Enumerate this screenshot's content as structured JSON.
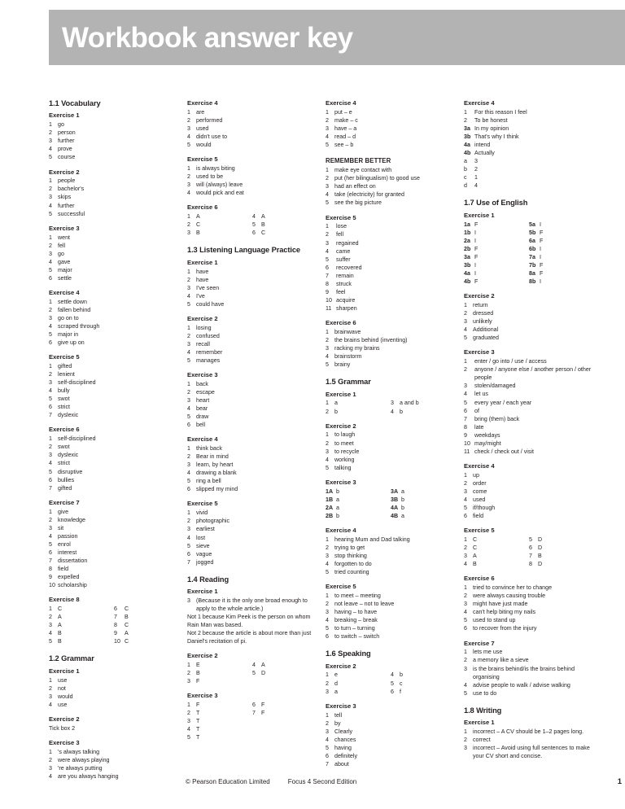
{
  "header": {
    "title": "Workbook answer key"
  },
  "footer": {
    "copyright": "© Pearson Education Limited",
    "edition": "Focus 4 Second Edition",
    "page_number": "1"
  },
  "sections": {
    "s11": {
      "title": "1.1 Vocabulary"
    },
    "s12": {
      "title": "1.2 Grammar"
    },
    "s13": {
      "title": "1.3 Listening Language Practice"
    },
    "s14": {
      "title": "1.4 Reading"
    },
    "s15": {
      "title": "1.5 Grammar"
    },
    "s16": {
      "title": "1.6 Speaking"
    },
    "s17": {
      "title": "1.7 Use of English"
    },
    "s18": {
      "title": "1.8 Writing"
    }
  },
  "labels": {
    "ex1": "Exercise 1",
    "ex2": "Exercise 2",
    "ex3": "Exercise 3",
    "ex4": "Exercise 4",
    "ex5": "Exercise 5",
    "ex6": "Exercise 6",
    "ex7": "Exercise 7",
    "ex8": "Exercise 8",
    "remember_better": "REMEMBER BETTER"
  },
  "col1": {
    "v_ex1": [
      {
        "n": "1",
        "t": "go"
      },
      {
        "n": "2",
        "t": "person"
      },
      {
        "n": "3",
        "t": "further"
      },
      {
        "n": "4",
        "t": "prove"
      },
      {
        "n": "5",
        "t": "course"
      }
    ],
    "v_ex2": [
      {
        "n": "1",
        "t": "people"
      },
      {
        "n": "2",
        "t": "bachelor's"
      },
      {
        "n": "3",
        "t": "skips"
      },
      {
        "n": "4",
        "t": "further"
      },
      {
        "n": "5",
        "t": "successful"
      }
    ],
    "v_ex3": [
      {
        "n": "1",
        "t": "went"
      },
      {
        "n": "2",
        "t": "fell"
      },
      {
        "n": "3",
        "t": "go"
      },
      {
        "n": "4",
        "t": "gave"
      },
      {
        "n": "5",
        "t": "major"
      },
      {
        "n": "6",
        "t": "settle"
      }
    ],
    "v_ex4": [
      {
        "n": "1",
        "t": "settle down"
      },
      {
        "n": "2",
        "t": "fallen behind"
      },
      {
        "n": "3",
        "t": "go on to"
      },
      {
        "n": "4",
        "t": "scraped through"
      },
      {
        "n": "5",
        "t": "major in"
      },
      {
        "n": "6",
        "t": "give up on"
      }
    ],
    "v_ex5": [
      {
        "n": "1",
        "t": "gifted"
      },
      {
        "n": "2",
        "t": "lenient"
      },
      {
        "n": "3",
        "t": "self-disciplined"
      },
      {
        "n": "4",
        "t": "bully"
      },
      {
        "n": "5",
        "t": "swot"
      },
      {
        "n": "6",
        "t": "strict"
      },
      {
        "n": "7",
        "t": "dyslexic"
      }
    ],
    "v_ex6": [
      {
        "n": "1",
        "t": "self-disciplined"
      },
      {
        "n": "2",
        "t": "swot"
      },
      {
        "n": "3",
        "t": "dyslexic"
      },
      {
        "n": "4",
        "t": "strict"
      },
      {
        "n": "5",
        "t": "disruptive"
      },
      {
        "n": "6",
        "t": "bullies"
      },
      {
        "n": "7",
        "t": "gifted"
      }
    ],
    "v_ex7": [
      {
        "n": "1",
        "t": "give"
      },
      {
        "n": "2",
        "t": "knowledge"
      },
      {
        "n": "3",
        "t": "sit"
      },
      {
        "n": "4",
        "t": "passion"
      },
      {
        "n": "5",
        "t": "enrol"
      },
      {
        "n": "6",
        "t": "interest"
      },
      {
        "n": "7",
        "t": "dissertation"
      },
      {
        "n": "8",
        "t": "field"
      },
      {
        "n": "9",
        "t": "expelled"
      },
      {
        "n": "10",
        "t": "scholarship"
      }
    ],
    "v_ex8_left": [
      {
        "n": "1",
        "t": "C"
      },
      {
        "n": "2",
        "t": "A"
      },
      {
        "n": "3",
        "t": "A"
      },
      {
        "n": "4",
        "t": "B"
      },
      {
        "n": "5",
        "t": "B"
      }
    ],
    "v_ex8_right": [
      {
        "n": "6",
        "t": "C"
      },
      {
        "n": "7",
        "t": "B"
      },
      {
        "n": "8",
        "t": "C"
      },
      {
        "n": "9",
        "t": "A"
      },
      {
        "n": "10",
        "t": "C"
      }
    ],
    "g_ex1": [
      {
        "n": "1",
        "t": "use"
      },
      {
        "n": "2",
        "t": "not"
      },
      {
        "n": "3",
        "t": "would"
      },
      {
        "n": "4",
        "t": "use"
      }
    ],
    "g_ex2_text": "Tick box 2",
    "g_ex3": [
      {
        "n": "1",
        "t": "'s always talking"
      },
      {
        "n": "2",
        "t": "were always playing"
      },
      {
        "n": "3",
        "t": "'re always putting"
      },
      {
        "n": "4",
        "t": "are you always hanging"
      }
    ]
  },
  "col2": {
    "g_ex4": [
      {
        "n": "1",
        "t": "are"
      },
      {
        "n": "2",
        "t": "performed"
      },
      {
        "n": "3",
        "t": "used"
      },
      {
        "n": "4",
        "t": "didn't use to"
      },
      {
        "n": "5",
        "t": "would"
      }
    ],
    "g_ex5": [
      {
        "n": "1",
        "t": "is always biting"
      },
      {
        "n": "2",
        "t": "used to be"
      },
      {
        "n": "3",
        "t": "will (always) leave"
      },
      {
        "n": "4",
        "t": "would pick and eat"
      }
    ],
    "g_ex6_left": [
      {
        "n": "1",
        "t": "A"
      },
      {
        "n": "2",
        "t": "C"
      },
      {
        "n": "3",
        "t": "B"
      }
    ],
    "g_ex6_right": [
      {
        "n": "4",
        "t": "A"
      },
      {
        "n": "5",
        "t": "B"
      },
      {
        "n": "6",
        "t": "C"
      }
    ],
    "l_ex1": [
      {
        "n": "1",
        "t": "have"
      },
      {
        "n": "2",
        "t": "have"
      },
      {
        "n": "3",
        "t": "I've seen"
      },
      {
        "n": "4",
        "t": "I've"
      },
      {
        "n": "5",
        "t": "could have"
      }
    ],
    "l_ex2": [
      {
        "n": "1",
        "t": "losing"
      },
      {
        "n": "2",
        "t": "confused"
      },
      {
        "n": "3",
        "t": "recall"
      },
      {
        "n": "4",
        "t": "remember"
      },
      {
        "n": "5",
        "t": "manages"
      }
    ],
    "l_ex3": [
      {
        "n": "1",
        "t": "back"
      },
      {
        "n": "2",
        "t": "escape"
      },
      {
        "n": "3",
        "t": "heart"
      },
      {
        "n": "4",
        "t": "bear"
      },
      {
        "n": "5",
        "t": "draw"
      },
      {
        "n": "6",
        "t": "bell"
      }
    ],
    "l_ex4": [
      {
        "n": "1",
        "t": "think back"
      },
      {
        "n": "2",
        "t": "Bear in mind"
      },
      {
        "n": "3",
        "t": "learn, by heart"
      },
      {
        "n": "4",
        "t": "drawing a blank"
      },
      {
        "n": "5",
        "t": "ring a bell"
      },
      {
        "n": "6",
        "t": "slipped my mind"
      }
    ],
    "l_ex5": [
      {
        "n": "1",
        "t": "vivid"
      },
      {
        "n": "2",
        "t": "photographic"
      },
      {
        "n": "3",
        "t": "earliest"
      },
      {
        "n": "4",
        "t": "lost"
      },
      {
        "n": "5",
        "t": "sieve"
      },
      {
        "n": "6",
        "t": "vague"
      },
      {
        "n": "7",
        "t": "jogged"
      }
    ],
    "r_ex1_num": "3",
    "r_ex1_main": "(Because it is the only one broad enough to apply to the whole article.)",
    "r_ex1_p2": "Not 1 because Kim Peek is the person on whom Rain Man was based.",
    "r_ex1_p3": "Not 2 because the article is about more than just Daniel's recitation of pi.",
    "r_ex2_left": [
      {
        "n": "1",
        "t": "E"
      },
      {
        "n": "2",
        "t": "B"
      },
      {
        "n": "3",
        "t": "F"
      }
    ],
    "r_ex2_right": [
      {
        "n": "4",
        "t": "A"
      },
      {
        "n": "5",
        "t": "D"
      }
    ],
    "r_ex3_left": [
      {
        "n": "1",
        "t": "F"
      },
      {
        "n": "2",
        "t": "T"
      },
      {
        "n": "3",
        "t": "T"
      },
      {
        "n": "4",
        "t": "T"
      },
      {
        "n": "5",
        "t": "T"
      }
    ],
    "r_ex3_right": [
      {
        "n": "6",
        "t": "F"
      },
      {
        "n": "7",
        "t": "F"
      }
    ]
  },
  "col3": {
    "r_ex4": [
      {
        "n": "1",
        "t": "put – e"
      },
      {
        "n": "2",
        "t": "make – c"
      },
      {
        "n": "3",
        "t": "have – a"
      },
      {
        "n": "4",
        "t": "read – d"
      },
      {
        "n": "5",
        "t": "see – b"
      }
    ],
    "remember_better": [
      {
        "n": "1",
        "t": "make eye contact with"
      },
      {
        "n": "2",
        "t": "put (her bilingualism) to good use"
      },
      {
        "n": "3",
        "t": "had an effect on"
      },
      {
        "n": "4",
        "t": "take (electricity) for granted"
      },
      {
        "n": "5",
        "t": "see the big picture"
      }
    ],
    "r_ex5": [
      {
        "n": "1",
        "t": "lose"
      },
      {
        "n": "2",
        "t": "fell"
      },
      {
        "n": "3",
        "t": "regained"
      },
      {
        "n": "4",
        "t": "came"
      },
      {
        "n": "5",
        "t": "suffer"
      },
      {
        "n": "6",
        "t": "recovered"
      },
      {
        "n": "7",
        "t": "remain"
      },
      {
        "n": "8",
        "t": "struck"
      },
      {
        "n": "9",
        "t": "feel"
      },
      {
        "n": "10",
        "t": "acquire"
      },
      {
        "n": "11",
        "t": "sharpen"
      }
    ],
    "r_ex6": [
      {
        "n": "1",
        "t": "brainwave"
      },
      {
        "n": "2",
        "t": "the brains behind (inventing)"
      },
      {
        "n": "3",
        "t": "racking my brains"
      },
      {
        "n": "4",
        "t": "brainstorm"
      },
      {
        "n": "5",
        "t": "brainy"
      }
    ],
    "g5_ex1_left": [
      {
        "n": "1",
        "t": "a"
      },
      {
        "n": "2",
        "t": "b"
      }
    ],
    "g5_ex1_right": [
      {
        "n": "3",
        "t": "a and b"
      },
      {
        "n": "4",
        "t": "b"
      }
    ],
    "g5_ex2": [
      {
        "n": "1",
        "t": "to laugh"
      },
      {
        "n": "2",
        "t": "to meet"
      },
      {
        "n": "3",
        "t": "to recycle"
      },
      {
        "n": "4",
        "t": "working"
      },
      {
        "n": "5",
        "t": "talking"
      }
    ],
    "g5_ex3_left": [
      {
        "n": "1A",
        "t": "b"
      },
      {
        "n": "1B",
        "t": "a"
      },
      {
        "n": "2A",
        "t": "a"
      },
      {
        "n": "2B",
        "t": "b"
      }
    ],
    "g5_ex3_right": [
      {
        "n": "3A",
        "t": "a"
      },
      {
        "n": "3B",
        "t": "b"
      },
      {
        "n": "4A",
        "t": "b"
      },
      {
        "n": "4B",
        "t": "a"
      }
    ],
    "g5_ex4": [
      {
        "n": "1",
        "t": "hearing Mum and Dad talking"
      },
      {
        "n": "2",
        "t": "trying to get"
      },
      {
        "n": "3",
        "t": "stop thinking"
      },
      {
        "n": "4",
        "t": "forgotten to do"
      },
      {
        "n": "5",
        "t": "tried counting"
      }
    ],
    "g5_ex5": [
      {
        "n": "1",
        "t": "to meet – meeting"
      },
      {
        "n": "2",
        "t": "not leave – not to leave"
      },
      {
        "n": "3",
        "t": "having – to have"
      },
      {
        "n": "4",
        "t": "breaking – break"
      },
      {
        "n": "5",
        "t": "to turn – turning"
      },
      {
        "n": "6",
        "t": "to switch – switch"
      }
    ],
    "sp_ex2_left": [
      {
        "n": "1",
        "t": "e"
      },
      {
        "n": "2",
        "t": "d"
      },
      {
        "n": "3",
        "t": "a"
      }
    ],
    "sp_ex2_right": [
      {
        "n": "4",
        "t": "b"
      },
      {
        "n": "5",
        "t": "c"
      },
      {
        "n": "6",
        "t": "f"
      }
    ],
    "sp_ex3": [
      {
        "n": "1",
        "t": "tell"
      },
      {
        "n": "2",
        "t": "by"
      },
      {
        "n": "3",
        "t": "Clearly"
      },
      {
        "n": "4",
        "t": "chances"
      },
      {
        "n": "5",
        "t": "having"
      },
      {
        "n": "6",
        "t": "definitely"
      },
      {
        "n": "7",
        "t": "about"
      }
    ]
  },
  "col4": {
    "sp_ex4": [
      {
        "n": "1",
        "t": "For this reason I feel",
        "bold": false
      },
      {
        "n": "2",
        "t": "To be honest",
        "bold": false
      },
      {
        "n": "3a",
        "t": "In my opinion",
        "bold": true
      },
      {
        "n": "3b",
        "t": "That's why I think",
        "bold": true
      },
      {
        "n": "4a",
        "t": "intend",
        "bold": true
      },
      {
        "n": "4b",
        "t": "Actually",
        "bold": true
      },
      {
        "n": "a",
        "t": "3",
        "bold": false
      },
      {
        "n": "b",
        "t": "2",
        "bold": false
      },
      {
        "n": "c",
        "t": "1",
        "bold": false
      },
      {
        "n": "d",
        "t": "4",
        "bold": false
      }
    ],
    "ue_ex1_left": [
      {
        "n": "1a",
        "t": "F"
      },
      {
        "n": "1b",
        "t": "I"
      },
      {
        "n": "2a",
        "t": "I"
      },
      {
        "n": "2b",
        "t": "F"
      },
      {
        "n": "3a",
        "t": "F"
      },
      {
        "n": "3b",
        "t": "I"
      },
      {
        "n": "4a",
        "t": "I"
      },
      {
        "n": "4b",
        "t": "F"
      }
    ],
    "ue_ex1_right": [
      {
        "n": "5a",
        "t": "I"
      },
      {
        "n": "5b",
        "t": "F"
      },
      {
        "n": "6a",
        "t": "F"
      },
      {
        "n": "6b",
        "t": "I"
      },
      {
        "n": "7a",
        "t": "I"
      },
      {
        "n": "7b",
        "t": "F"
      },
      {
        "n": "8a",
        "t": "F"
      },
      {
        "n": "8b",
        "t": "I"
      }
    ],
    "ue_ex2": [
      {
        "n": "1",
        "t": "return"
      },
      {
        "n": "2",
        "t": "dressed"
      },
      {
        "n": "3",
        "t": "unlikely"
      },
      {
        "n": "4",
        "t": "Additional"
      },
      {
        "n": "5",
        "t": "graduated"
      }
    ],
    "ue_ex3": [
      {
        "n": "1",
        "t": "enter / go into / use / access"
      },
      {
        "n": "2",
        "t": "anyone / anyone else / another person / other people"
      },
      {
        "n": "3",
        "t": "stolen/damaged"
      },
      {
        "n": "4",
        "t": "let us"
      },
      {
        "n": "5",
        "t": "every year / each year"
      },
      {
        "n": "6",
        "t": "of"
      },
      {
        "n": "7",
        "t": "bring (them) back"
      },
      {
        "n": "8",
        "t": "late"
      },
      {
        "n": "9",
        "t": "weekdays"
      },
      {
        "n": "10",
        "t": "may/might"
      },
      {
        "n": "11",
        "t": "check / check out / visit"
      }
    ],
    "ue_ex4": [
      {
        "n": "1",
        "t": "up"
      },
      {
        "n": "2",
        "t": "order"
      },
      {
        "n": "3",
        "t": "come"
      },
      {
        "n": "4",
        "t": "used"
      },
      {
        "n": "5",
        "t": "if/though"
      },
      {
        "n": "6",
        "t": "field"
      }
    ],
    "ue_ex5_left": [
      {
        "n": "1",
        "t": "C"
      },
      {
        "n": "2",
        "t": "C"
      },
      {
        "n": "3",
        "t": "A"
      },
      {
        "n": "4",
        "t": "B"
      }
    ],
    "ue_ex5_right": [
      {
        "n": "5",
        "t": "D"
      },
      {
        "n": "6",
        "t": "D"
      },
      {
        "n": "7",
        "t": "B"
      },
      {
        "n": "8",
        "t": "D"
      }
    ],
    "ue_ex6": [
      {
        "n": "1",
        "t": "tried to convince her to change"
      },
      {
        "n": "2",
        "t": "were always causing trouble"
      },
      {
        "n": "3",
        "t": "might have just made"
      },
      {
        "n": "4",
        "t": "can't help biting my nails"
      },
      {
        "n": "5",
        "t": "used to stand up"
      },
      {
        "n": "6",
        "t": "to recover from the injury"
      }
    ],
    "ue_ex7": [
      {
        "n": "1",
        "t": "lets me use"
      },
      {
        "n": "2",
        "t": "a memory like a sieve"
      },
      {
        "n": "3",
        "t": "is the brains behind/is the brains behind organising"
      },
      {
        "n": "4",
        "t": "advise people to walk / advise walking"
      },
      {
        "n": "5",
        "t": "use to do"
      }
    ],
    "wr_ex1": [
      {
        "n": "1",
        "t": "incorrect – A CV should be 1–2 pages long."
      },
      {
        "n": "2",
        "t": "correct"
      },
      {
        "n": "3",
        "t": "incorrect – Avoid using full sentences to make your CV short and concise."
      }
    ]
  }
}
